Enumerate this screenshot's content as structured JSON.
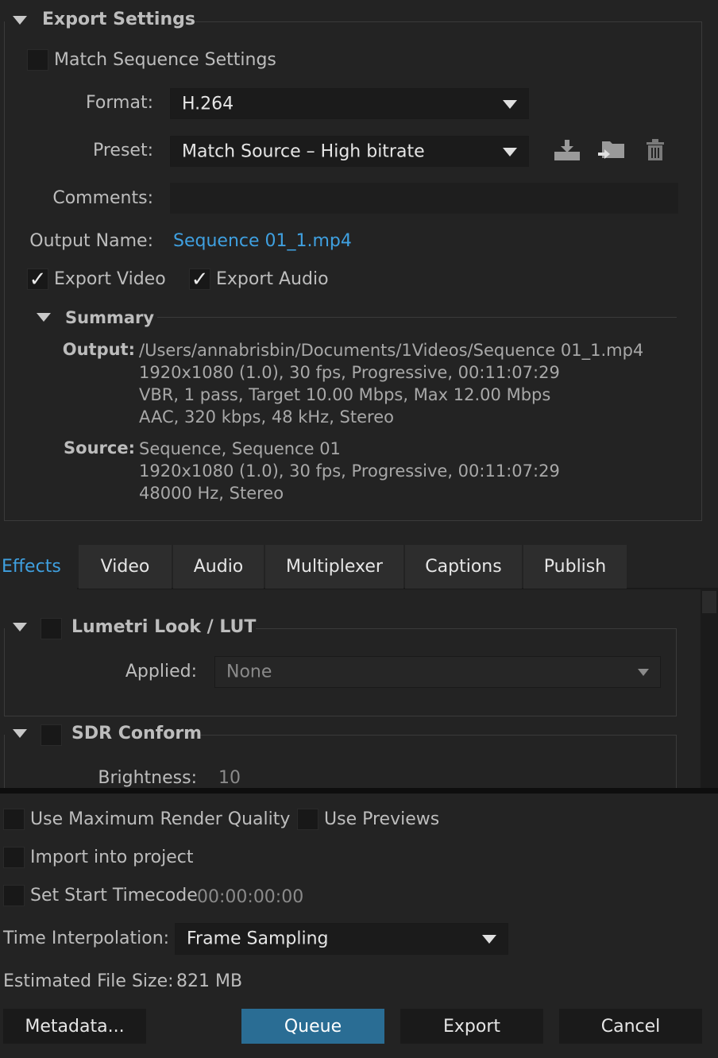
{
  "export_settings": {
    "title": "Export Settings",
    "match_sequence_label": "Match Sequence Settings",
    "match_sequence_checked": false,
    "format_label": "Format:",
    "format_value": "H.264",
    "preset_label": "Preset:",
    "preset_value": "Match Source – High bitrate",
    "comments_label": "Comments:",
    "comments_value": "",
    "output_name_label": "Output Name:",
    "output_name_value": "Sequence 01_1.mp4",
    "export_video_label": "Export Video",
    "export_video_checked": true,
    "export_audio_label": "Export Audio",
    "export_audio_checked": true,
    "preset_icons": [
      "save-preset-icon",
      "import-preset-icon",
      "delete-preset-icon"
    ]
  },
  "summary": {
    "title": "Summary",
    "output_label": "Output:",
    "output_lines": [
      "/Users/annabrisbin/Documents/1Videos/Sequence 01_1.mp4",
      "1920x1080 (1.0), 30 fps, Progressive, 00:11:07:29",
      "VBR, 1 pass, Target 10.00 Mbps, Max 12.00 Mbps",
      "AAC, 320 kbps, 48 kHz, Stereo"
    ],
    "source_label": "Source:",
    "source_lines": [
      "Sequence, Sequence 01",
      "1920x1080 (1.0), 30 fps, Progressive, 00:11:07:29",
      "48000 Hz, Stereo"
    ]
  },
  "tabs": [
    {
      "label": "Effects",
      "active": true
    },
    {
      "label": "Video",
      "active": false
    },
    {
      "label": "Audio",
      "active": false
    },
    {
      "label": "Multiplexer",
      "active": false
    },
    {
      "label": "Captions",
      "active": false
    },
    {
      "label": "Publish",
      "active": false
    }
  ],
  "effects": {
    "lumetri": {
      "title": "Lumetri Look / LUT",
      "enabled": false,
      "applied_label": "Applied:",
      "applied_value": "None"
    },
    "sdr_conform": {
      "title": "SDR Conform",
      "enabled": false,
      "brightness_label": "Brightness:",
      "brightness_value": "10"
    }
  },
  "bottom": {
    "max_render_label": "Use Maximum Render Quality",
    "use_previews_label": "Use Previews",
    "import_project_label": "Import into project",
    "set_start_tc_label": "Set Start Timecode",
    "start_tc_value": "00:00:00:00",
    "time_interp_label": "Time Interpolation:",
    "time_interp_value": "Frame Sampling",
    "est_size_label": "Estimated File Size:",
    "est_size_value": "821 MB"
  },
  "buttons": {
    "metadata": "Metadata...",
    "queue": "Queue",
    "export": "Export",
    "cancel": "Cancel"
  },
  "colors": {
    "accent_link": "#3fa0e0",
    "primary_button": "#2a6d94",
    "background": "#232323"
  }
}
